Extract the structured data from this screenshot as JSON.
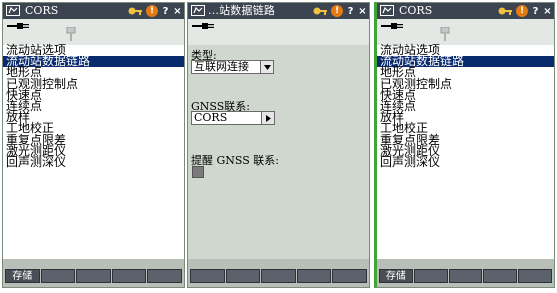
{
  "screens": [
    {
      "title": "CORS",
      "list_items": [
        "流动站选项",
        "流动站数据链路",
        "地形点",
        "已观测控制点",
        "快速点",
        "连续点",
        "放样",
        "工地校正",
        "重复点限差",
        "激光测距仪",
        "回声测深仪"
      ],
      "selected_index": 1,
      "softkeys": [
        "存储",
        "",
        "",
        "",
        ""
      ]
    },
    {
      "title": "...站数据链路",
      "type_label": "类型:",
      "type_value": "互联网连接",
      "gnss_label": "GNSS联系:",
      "gnss_value": "CORS",
      "prompt_label": "提醒 GNSS 联系:",
      "prompt_checked": true,
      "softkeys": [
        "",
        "",
        "",
        "",
        ""
      ]
    },
    {
      "title": "CORS",
      "list_items": [
        "流动站选项",
        "流动站数据链路",
        "地形点",
        "已观测控制点",
        "快速点",
        "连续点",
        "放样",
        "工地校正",
        "重复点限差",
        "激光测距仪",
        "回声测深仪"
      ],
      "selected_index": 1,
      "softkeys": [
        "存储",
        "",
        "",
        "",
        ""
      ]
    }
  ],
  "titlebar_icons": {
    "warning_glyph": "!",
    "help_glyph": "?",
    "close_glyph": "×"
  },
  "colors": {
    "titlebar": "#3b4450",
    "selection": "#0a2a6e",
    "warning": "#e37a12",
    "accent_border": "#3fa535"
  }
}
